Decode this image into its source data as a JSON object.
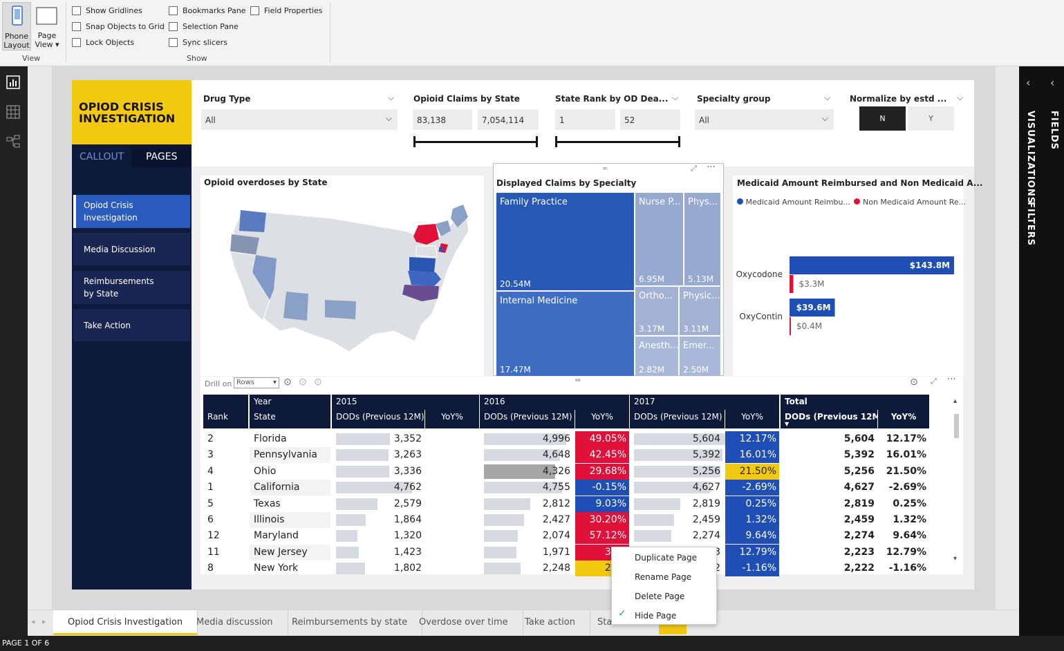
{
  "ribbon": {
    "view_buttons": [
      {
        "label1": "Phone",
        "label2": "Layout"
      },
      {
        "label1": "Page",
        "label2": "View ▾"
      }
    ],
    "view_group": "View",
    "show_group": "Show",
    "checkboxes": [
      "Show Gridlines",
      "Snap Objects to Grid",
      "Lock Objects",
      "Bookmarks Pane",
      "Selection Pane",
      "Sync slicers",
      "Field Properties"
    ]
  },
  "right_pane": {
    "fields": "FIELDS",
    "visualizations": "VISUALIZATIONS",
    "filters": "FILTERS"
  },
  "report": {
    "title": "OPIOD CRISIS INVESTIGATION",
    "nav_tabs": [
      "CALLOUT",
      "PAGES"
    ],
    "nav_items": [
      "Opiod Crisis Investigation",
      "Media Discussion",
      "Reimbursements by State",
      "Take Action"
    ]
  },
  "slicers": [
    {
      "label": "Drug Type",
      "value": "All"
    },
    {
      "label": "Opioid Claims by State",
      "min": "83,138",
      "max": "7,054,114"
    },
    {
      "label": "State Rank by OD Dea...",
      "min": "1",
      "max": "52"
    },
    {
      "label": "Specialty group",
      "value": "All"
    },
    {
      "label": "Normalize by estd ...",
      "options": [
        "N",
        "Y"
      ],
      "selected": "N"
    }
  ],
  "map": {
    "title": "Opioid overdoses by State"
  },
  "treemap": {
    "title": "Displayed Claims by Specialty",
    "tiles": [
      {
        "name": "Family Practice",
        "value": "20.54M"
      },
      {
        "name": "Nurse P...",
        "value": "6.95M"
      },
      {
        "name": "Phys...",
        "value": "5.13M"
      },
      {
        "name": "Internal Medicine",
        "value": "17.47M"
      },
      {
        "name": "Ortho...",
        "value": "3.17M"
      },
      {
        "name": "Physic...",
        "value": "3.11M"
      },
      {
        "name": "Anesth...",
        "value": "2.82M"
      },
      {
        "name": "Emer...",
        "value": "2.50M"
      }
    ]
  },
  "medicaid": {
    "title": "Medicaid Amount Reimbursed and Non Medicaid A...",
    "legend": [
      "Medicaid Amount Reimbu...",
      "Non Medicaid Amount Re..."
    ],
    "colors": [
      "#1f4eb4",
      "#e0103a"
    ]
  },
  "chart_data": {
    "type": "bar",
    "title": "Medicaid Amount Reimbursed and Non Medicaid A...",
    "categories": [
      "Oxycodone",
      "OxyContin"
    ],
    "series": [
      {
        "name": "Medicaid Amount Reimbu...",
        "values": [
          143.8,
          39.6
        ],
        "labels": [
          "$143.8M",
          "$39.6M"
        ]
      },
      {
        "name": "Non Medicaid Amount Re...",
        "values": [
          3.3,
          0.4
        ],
        "labels": [
          "$3.3M",
          "$0.4M"
        ]
      }
    ]
  },
  "table": {
    "drill_label": "Drill on",
    "drill_value": "Rows",
    "headers_top": [
      "Year",
      "2015",
      "2016",
      "2017",
      "Total"
    ],
    "headers": [
      "Rank",
      "State",
      "DODs (Previous 12M)",
      "YoY%",
      "DODs (Previous 12M)",
      "YoY%",
      "DODs (Previous 12M)",
      "YoY%",
      "DODs (Previous 12M)",
      "YoY%"
    ],
    "rows": [
      {
        "rank": "2",
        "state": "Florida",
        "d15": "3,352",
        "d16": "4,996",
        "y16": "49.05%",
        "d17": "5,604",
        "y17": "12.17%",
        "dt": "5,604",
        "yt": "12.17%"
      },
      {
        "rank": "3",
        "state": "Pennsylvania",
        "d15": "3,263",
        "d16": "4,648",
        "y16": "42.45%",
        "d17": "5,392",
        "y17": "16.01%",
        "dt": "5,392",
        "yt": "16.01%"
      },
      {
        "rank": "4",
        "state": "Ohio",
        "d15": "3,336",
        "d16": "4,326",
        "y16": "29.68%",
        "d17": "5,256",
        "y17": "21.50%",
        "dt": "5,256",
        "yt": "21.50%"
      },
      {
        "rank": "1",
        "state": "California",
        "d15": "4,762",
        "d16": "4,755",
        "y16": "-0.15%",
        "d17": "4,627",
        "y17": "-2.69%",
        "dt": "4,627",
        "yt": "-2.69%"
      },
      {
        "rank": "5",
        "state": "Texas",
        "d15": "2,579",
        "d16": "2,812",
        "y16": "9.03%",
        "d17": "2,819",
        "y17": "0.25%",
        "dt": "2,819",
        "yt": "0.25%"
      },
      {
        "rank": "6",
        "state": "Illinois",
        "d15": "1,864",
        "d16": "2,427",
        "y16": "30.20%",
        "d17": "2,459",
        "y17": "1.32%",
        "dt": "2,459",
        "yt": "1.32%"
      },
      {
        "rank": "12",
        "state": "Maryland",
        "d15": "1,320",
        "d16": "2,074",
        "y16": "57.12%",
        "d17": "2,274",
        "y17": "9.64%",
        "dt": "2,274",
        "yt": "9.64%"
      },
      {
        "rank": "11",
        "state": "New Jersey",
        "d15": "1,423",
        "d16": "1,971",
        "y16": "38.5",
        "d17": "3",
        "y17": "12.79%",
        "dt": "2,223",
        "yt": "12.79%"
      },
      {
        "rank": "8",
        "state": "New York",
        "d15": "1,802",
        "d16": "2,248",
        "y16": "24.7",
        "d17": "2",
        "y17": "-1.16%",
        "dt": "2,222",
        "yt": "-1.16%"
      }
    ]
  },
  "context_menu": [
    "Duplicate Page",
    "Rename Page",
    "Delete Page",
    "Hide Page"
  ],
  "page_tabs": [
    "Opiod Crisis Investigation",
    "Media discussion",
    "Reimbursements by state",
    "Overdose over time",
    "Take action",
    "Stat"
  ],
  "status": "PAGE 1 OF 6"
}
